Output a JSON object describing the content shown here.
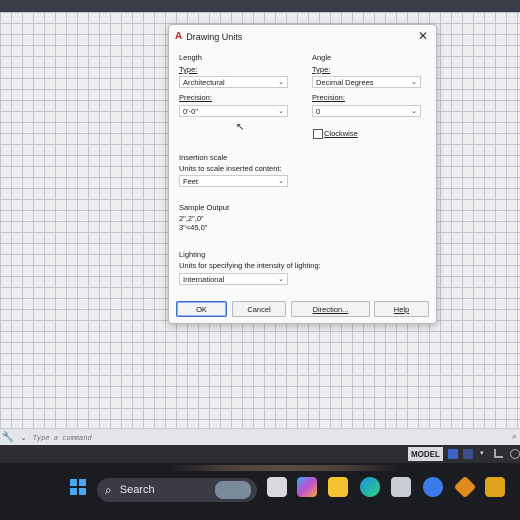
{
  "dialog": {
    "title": "Drawing Units",
    "length": {
      "heading": "Length",
      "type_label": "Type:",
      "type_value": "Architectural",
      "precision_label": "Precision:",
      "precision_value": "0'-0\""
    },
    "angle": {
      "heading": "Angle",
      "type_label": "Type:",
      "type_value": "Decimal Degrees",
      "precision_label": "Precision:",
      "precision_value": "0",
      "clockwise_label": "Clockwise",
      "clockwise_checked": false
    },
    "insertion": {
      "heading": "Insertion scale",
      "sub": "Units to scale inserted content:",
      "value": "Feet"
    },
    "sample": {
      "heading": "Sample Output",
      "line1": "2\",2\",0\"",
      "line2": "3\"<45,0\""
    },
    "lighting": {
      "heading": "Lighting",
      "sub": "Units for specifying the intensity of lighting:",
      "value": "International"
    },
    "buttons": {
      "ok": "OK",
      "cancel": "Cancel",
      "direction": "Direction...",
      "help": "Help"
    }
  },
  "command_line": {
    "placeholder": "Type a command"
  },
  "status_bar": {
    "model": "MODEL"
  },
  "taskbar": {
    "search": "Search"
  },
  "icons": {
    "close": "close-icon",
    "chevron": "chevron-down-icon",
    "windows": "windows-start-icon",
    "search": "search-icon"
  }
}
